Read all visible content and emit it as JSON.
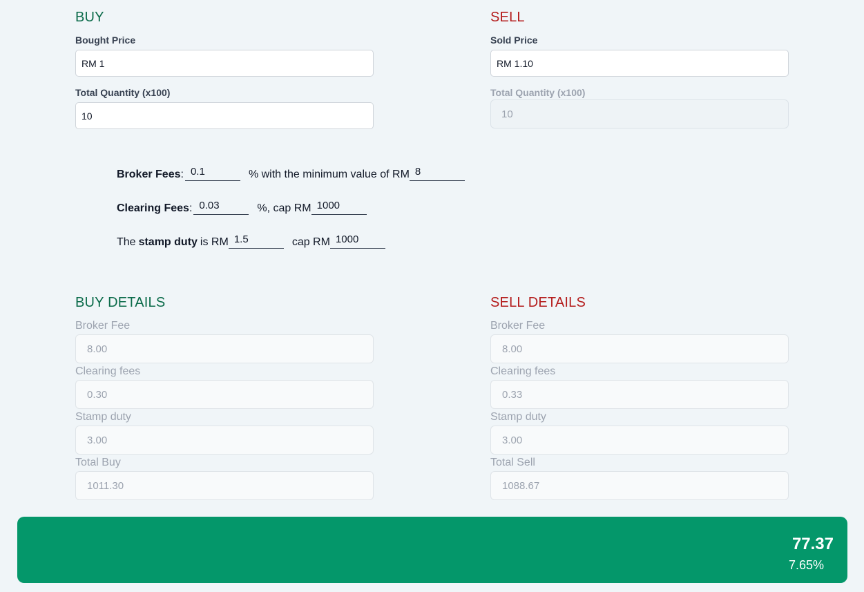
{
  "buy": {
    "heading": "BUY",
    "bought_price_label": "Bought Price",
    "bought_price_value": "RM 1",
    "quantity_label": "Total Quantity (x100)",
    "quantity_value": "10"
  },
  "sell": {
    "heading": "SELL",
    "sold_price_label": "Sold Price",
    "sold_price_value": "RM 1.10",
    "quantity_label": "Total Quantity (x100)",
    "quantity_value": "10"
  },
  "fees": {
    "broker_label": "Broker Fees",
    "broker_colon": ":",
    "broker_value": "0.1",
    "broker_text": "% with the minimum value of RM",
    "broker_min_value": "8",
    "clearing_label": "Clearing Fees",
    "clearing_colon": ":",
    "clearing_value": "0.03",
    "clearing_text": "%, cap RM",
    "clearing_cap_value": "1000",
    "stamp_prefix": "The",
    "stamp_label": "stamp duty",
    "stamp_text": "is RM",
    "stamp_value": "1.5",
    "stamp_cap_text": "cap RM",
    "stamp_cap_value": "1000"
  },
  "buy_details": {
    "heading": "BUY DETAILS",
    "broker_fee_label": "Broker Fee",
    "broker_fee_value": "8.00",
    "clearing_label": "Clearing fees",
    "clearing_value": "0.30",
    "stamp_label": "Stamp duty",
    "stamp_value": "3.00",
    "total_label": "Total Buy",
    "total_value": "1011.30"
  },
  "sell_details": {
    "heading": "SELL DETAILS",
    "broker_fee_label": "Broker Fee",
    "broker_fee_value": "8.00",
    "clearing_label": "Clearing fees",
    "clearing_value": "0.33",
    "stamp_label": "Stamp duty",
    "stamp_value": "3.00",
    "total_label": "Total Sell",
    "total_value": "1088.67"
  },
  "result": {
    "profit": "77.37",
    "percent": "7.65%"
  },
  "colors": {
    "buy": "#0b6b4a",
    "sell": "#b41c1c",
    "profit_bar": "#04976a"
  }
}
